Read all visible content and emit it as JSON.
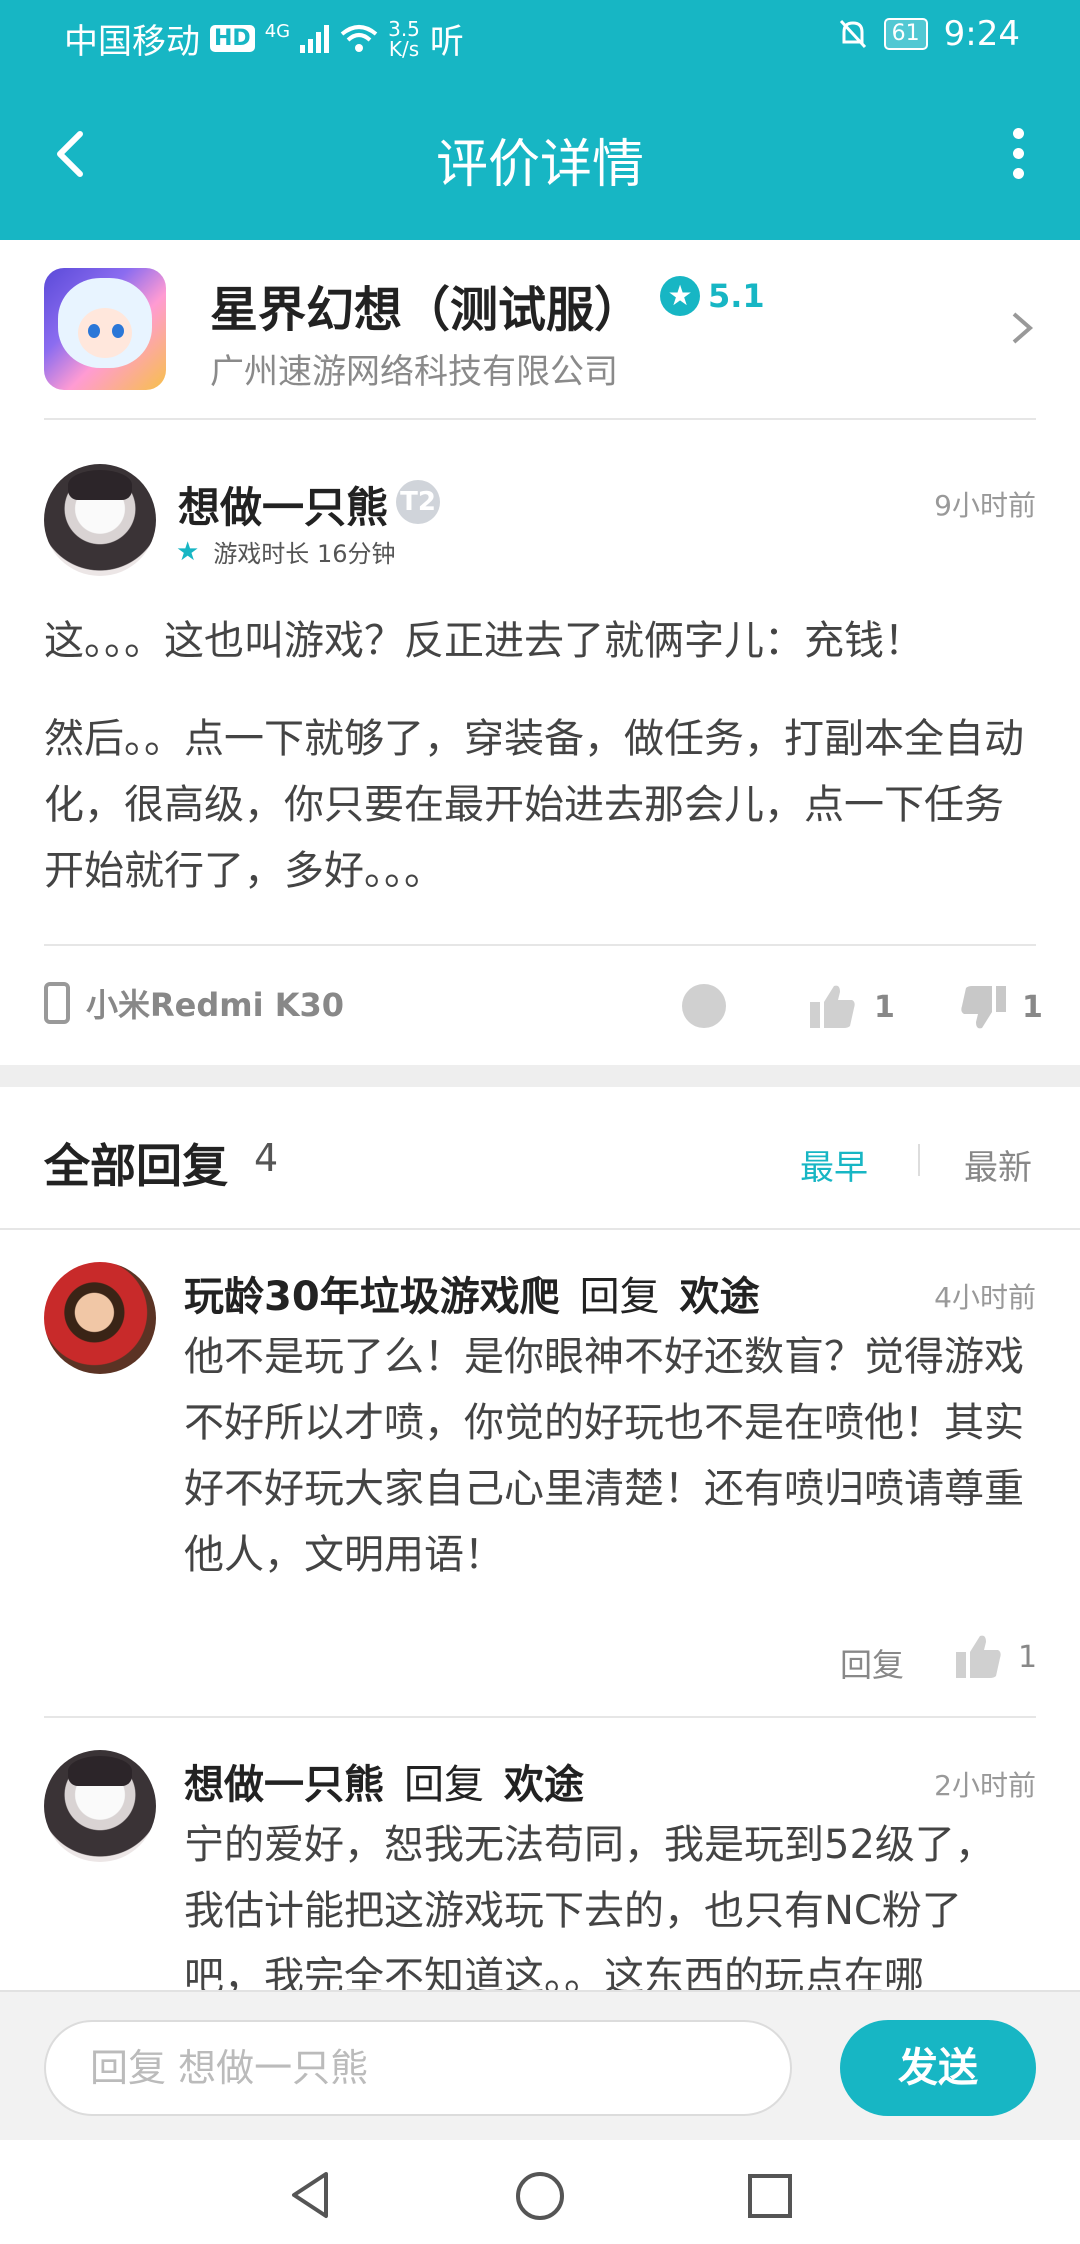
{
  "status_bar": {
    "carrier": "中国移动",
    "hd": "HD",
    "net_type": "4G",
    "speed_value": "3.5",
    "speed_unit": "K/s",
    "listen": "听",
    "battery": "61",
    "time": "9:24"
  },
  "header": {
    "title": "评价详情"
  },
  "game": {
    "name": "星界幻想（测试服）",
    "rating": "5.1",
    "developer": "广州速游网络科技有限公司"
  },
  "review": {
    "user": "想做一只熊",
    "badge": "T2",
    "playtime": "游戏时长 16分钟",
    "time": "9小时前",
    "paragraphs": [
      "这。。。这也叫游戏？反正进去了就俩字儿：充钱！",
      "然后。。点一下就够了，穿装备，做任务，打副本全自动化，很高级，你只要在最开始进去那会儿，点一下任务开始就行了，多好。。。"
    ],
    "device": "小米Redmi K30",
    "likes": "1",
    "dislikes": "1"
  },
  "replies_section": {
    "title": "全部回复",
    "count": "4",
    "sort_earliest": "最早",
    "sort_newest": "最新"
  },
  "replies": [
    {
      "user": "玩龄30年垃圾游戏爬",
      "action": "回复",
      "target": "欢途",
      "time": "4小时前",
      "content": "他不是玩了么！是你眼神不好还数盲？觉得游戏不好所以才喷，你觉的好玩也不是在喷他！其实好不好玩大家自己心里清楚！还有喷归喷请尊重他人，文明用语！",
      "reply_label": "回复",
      "likes": "1"
    },
    {
      "user": "想做一只熊",
      "action": "回复",
      "target": "欢途",
      "time": "2小时前",
      "content": "宁的爱好，恕我无法苟同，我是玩到52级了，我估计能把这游戏玩下去的，也只有NC粉了吧，我完全不知道这。。这东西的玩点在哪"
    }
  ],
  "input_bar": {
    "placeholder": "回复 想做一只熊",
    "send": "发送"
  },
  "colors": {
    "accent": "#17b6c4"
  }
}
